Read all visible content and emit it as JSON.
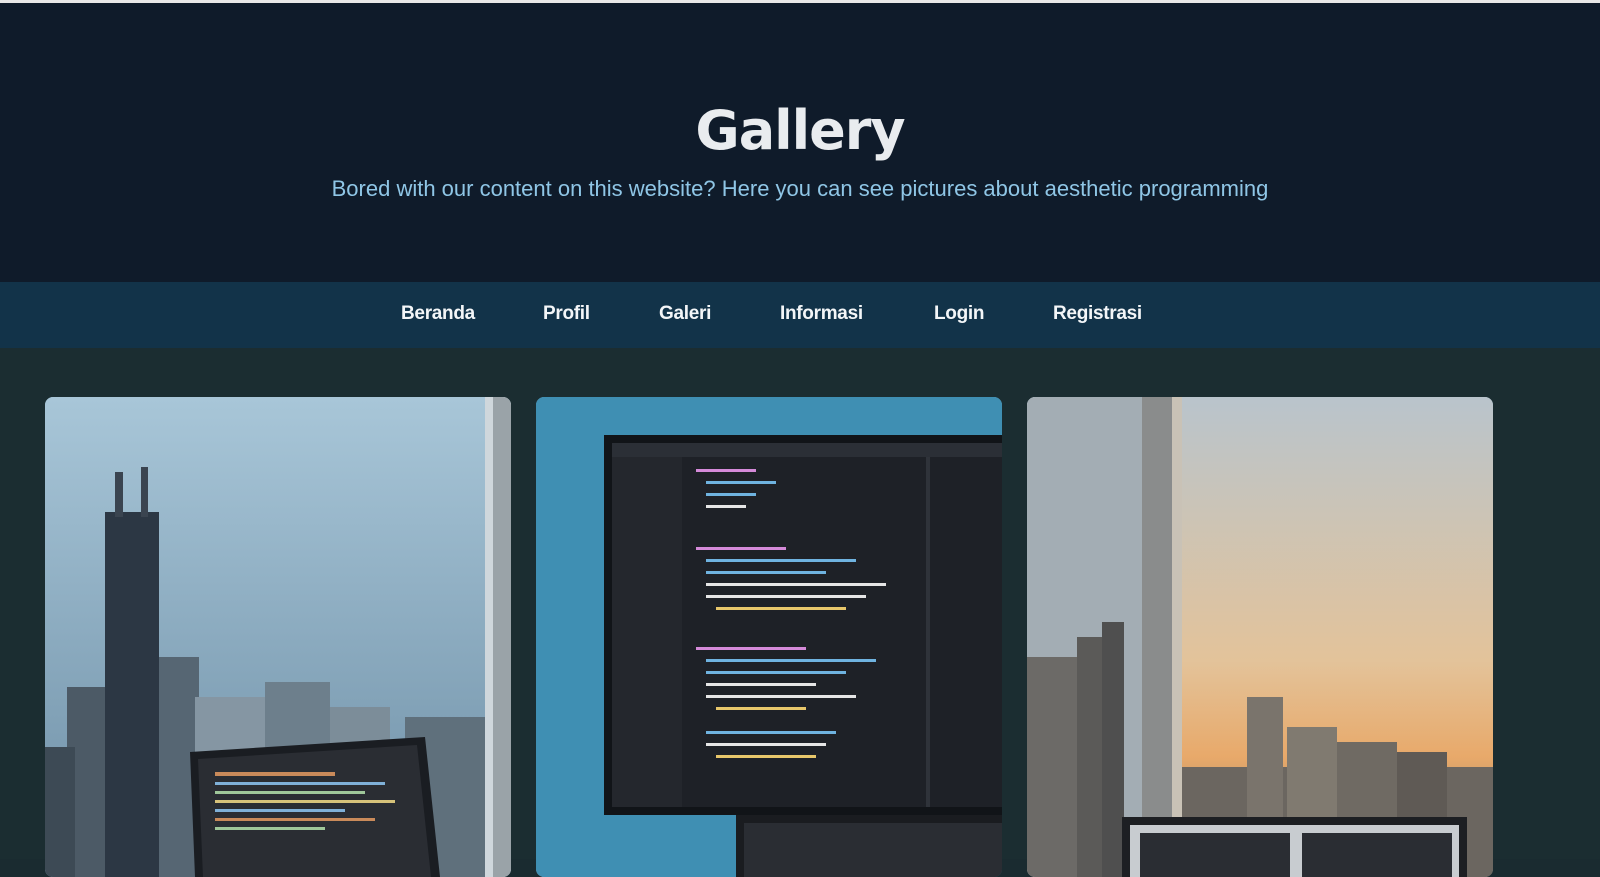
{
  "header": {
    "title": "Gallery",
    "subtitle": "Bored with our content on this website? Here you can see pictures about aesthetic programming"
  },
  "nav": {
    "items": [
      {
        "label": "Beranda"
      },
      {
        "label": "Profil"
      },
      {
        "label": "Galeri"
      },
      {
        "label": "Informasi"
      },
      {
        "label": "Login"
      },
      {
        "label": "Registrasi"
      }
    ]
  },
  "colors": {
    "header_bg": "#0f1b2a",
    "nav_bg": "#123349",
    "page_bg": "#1b2d31",
    "subtitle": "#8fc6e6"
  }
}
